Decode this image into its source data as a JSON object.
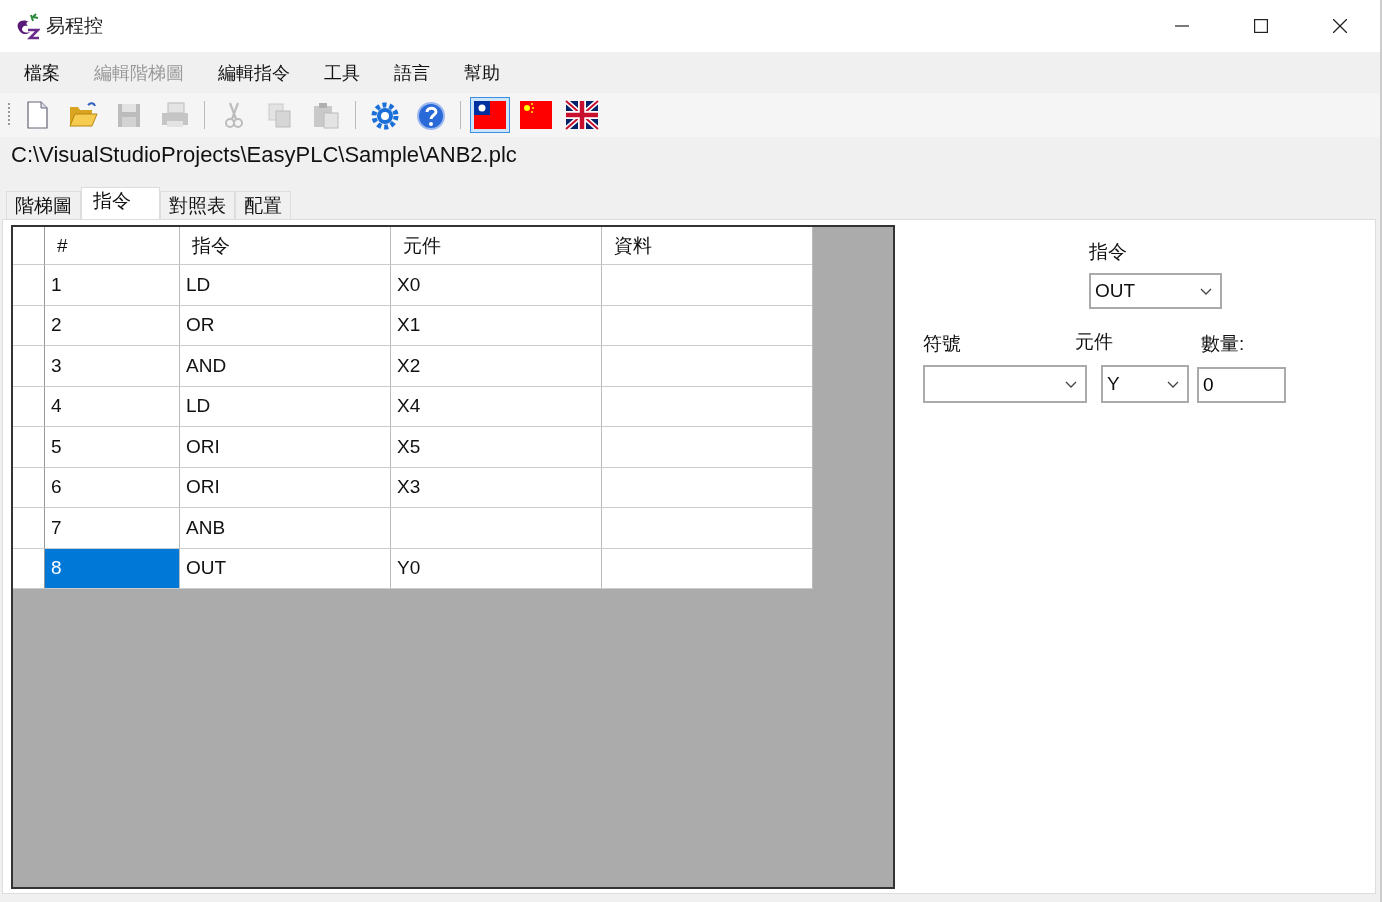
{
  "window": {
    "title": "易程控"
  },
  "menu": [
    {
      "label": "檔案",
      "disabled": false
    },
    {
      "label": "編輯階梯圖",
      "disabled": true
    },
    {
      "label": "編輯指令",
      "disabled": false
    },
    {
      "label": "工具",
      "disabled": false
    },
    {
      "label": "語言",
      "disabled": false
    },
    {
      "label": "幫助",
      "disabled": false
    }
  ],
  "toolbar": [
    {
      "kind": "new",
      "disabled": false,
      "selected": false
    },
    {
      "kind": "open",
      "disabled": false,
      "selected": false
    },
    {
      "kind": "save",
      "disabled": true,
      "selected": false
    },
    {
      "kind": "print",
      "disabled": true,
      "selected": false
    },
    {
      "kind": "sep"
    },
    {
      "kind": "cut",
      "disabled": true,
      "selected": false
    },
    {
      "kind": "copy",
      "disabled": true,
      "selected": false
    },
    {
      "kind": "paste",
      "disabled": true,
      "selected": false
    },
    {
      "kind": "sep"
    },
    {
      "kind": "settings",
      "disabled": false,
      "selected": false
    },
    {
      "kind": "help",
      "disabled": false,
      "selected": false
    },
    {
      "kind": "sep"
    },
    {
      "kind": "flag_tw",
      "disabled": false,
      "selected": true
    },
    {
      "kind": "flag_cn",
      "disabled": false,
      "selected": false
    },
    {
      "kind": "flag_uk",
      "disabled": false,
      "selected": false
    }
  ],
  "path": "C:\\VisualStudioProjects\\EasyPLC\\Sample\\ANB2.plc",
  "tabs": [
    {
      "label": "階梯圖",
      "selected": false
    },
    {
      "label": "指令",
      "selected": true
    },
    {
      "label": "對照表",
      "selected": false
    },
    {
      "label": "配置",
      "selected": false
    }
  ],
  "table": {
    "columns": [
      "#",
      "指令",
      "元件",
      "資料"
    ],
    "rows": [
      {
        "cells": [
          "1",
          "LD",
          "X0",
          ""
        ],
        "selected": false
      },
      {
        "cells": [
          "2",
          "OR",
          "X1",
          ""
        ],
        "selected": false
      },
      {
        "cells": [
          "3",
          "AND",
          "X2",
          ""
        ],
        "selected": false
      },
      {
        "cells": [
          "4",
          "LD",
          "X4",
          ""
        ],
        "selected": false
      },
      {
        "cells": [
          "5",
          "ORI",
          "X5",
          ""
        ],
        "selected": false
      },
      {
        "cells": [
          "6",
          "ORI",
          "X3",
          ""
        ],
        "selected": false
      },
      {
        "cells": [
          "7",
          "ANB",
          "",
          ""
        ],
        "selected": false
      },
      {
        "cells": [
          "8",
          "OUT",
          "Y0",
          ""
        ],
        "selected": true
      }
    ]
  },
  "editor": {
    "instruction_label": "指令",
    "instruction_value": "OUT",
    "symbol_label": "符號",
    "element_label": "元件",
    "element_value": "Y",
    "count_label": "數量:",
    "count_value": "0"
  }
}
